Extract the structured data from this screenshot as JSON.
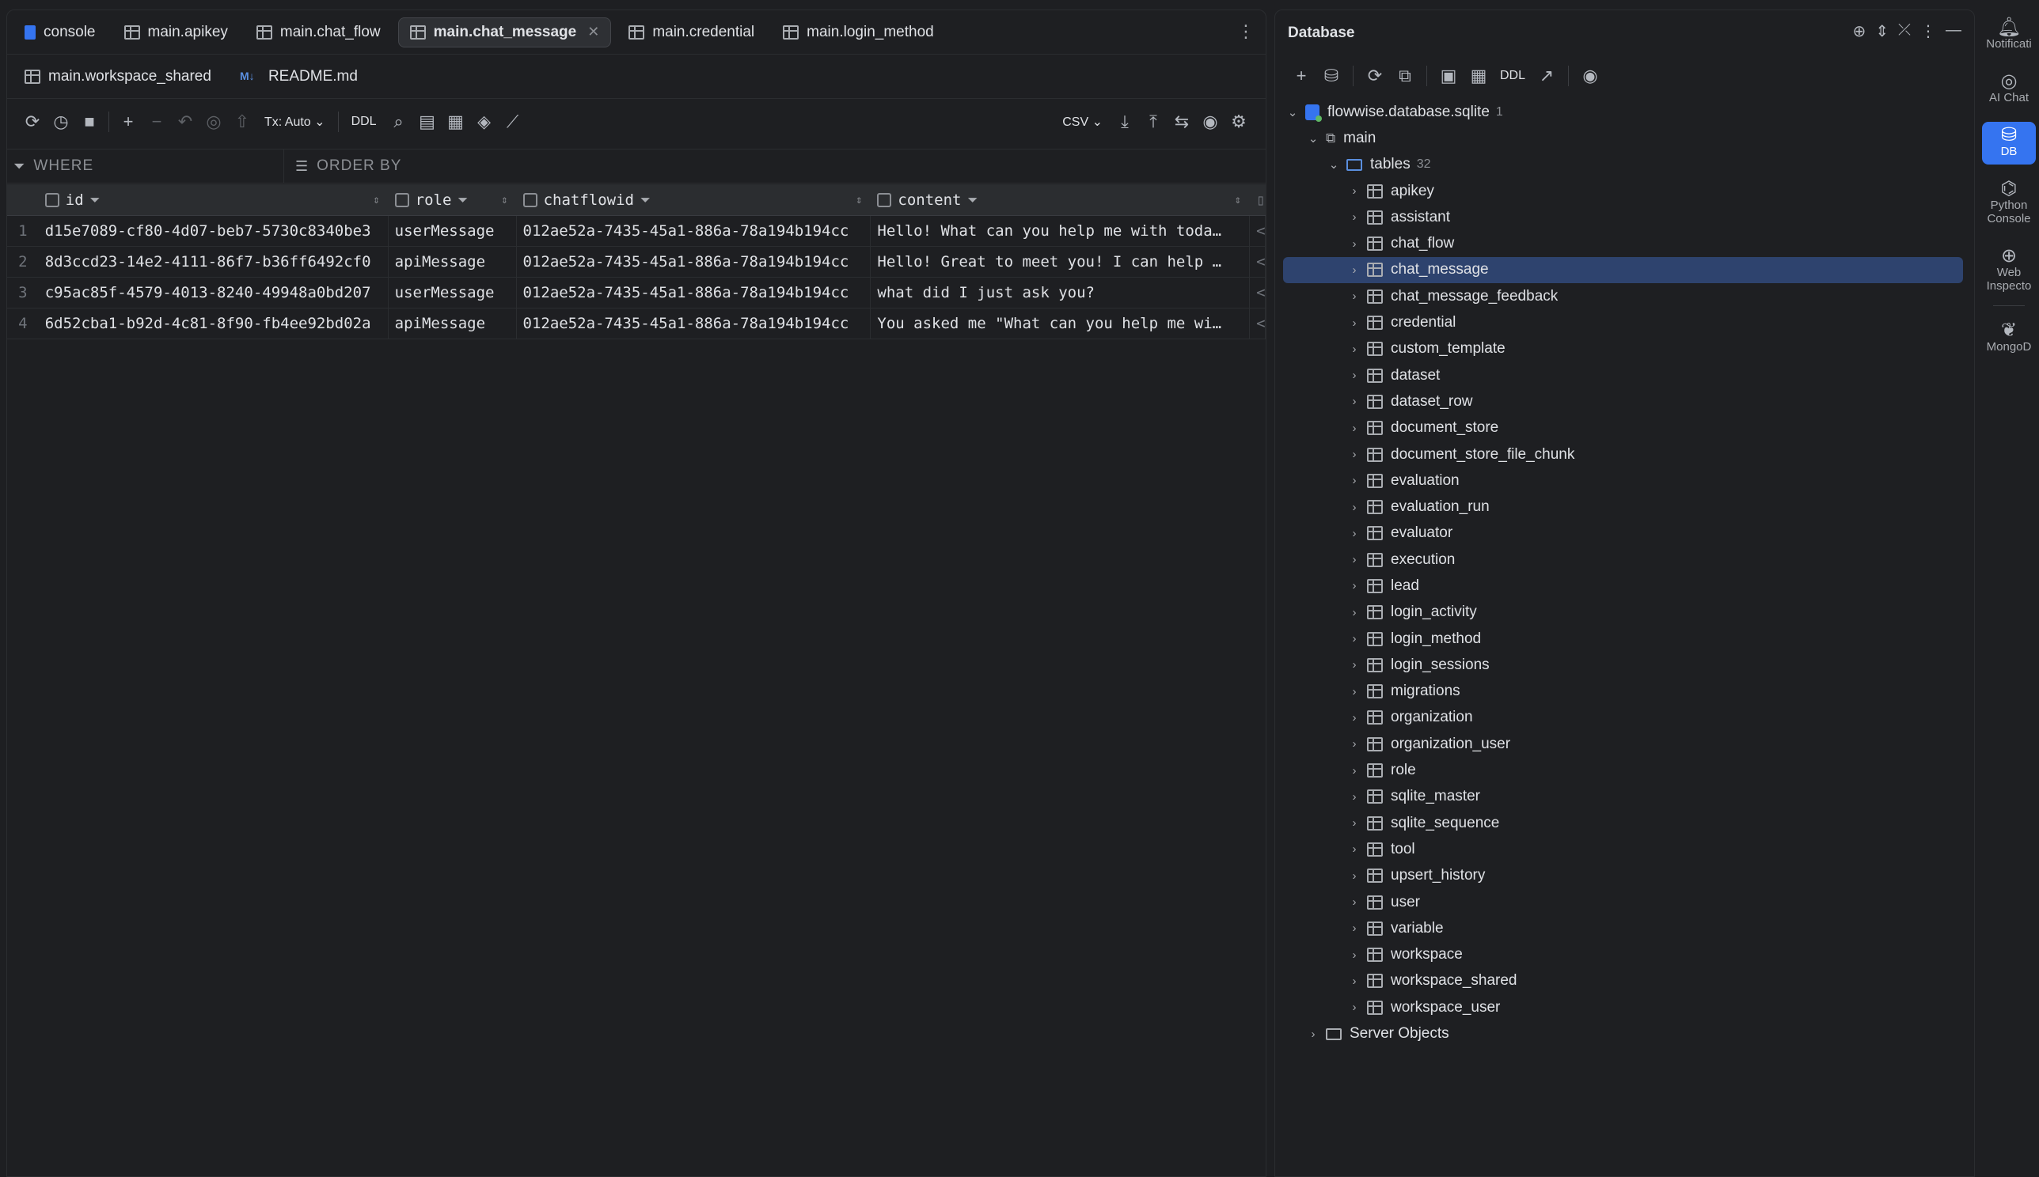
{
  "editor": {
    "tabs_row1": [
      {
        "label": "console",
        "icon": "console-icon",
        "active": false
      },
      {
        "label": "main.apikey",
        "icon": "table-icon",
        "active": false
      },
      {
        "label": "main.chat_flow",
        "icon": "table-icon",
        "active": false
      },
      {
        "label": "main.chat_message",
        "icon": "table-icon",
        "active": true
      },
      {
        "label": "main.credential",
        "icon": "table-icon",
        "active": false
      },
      {
        "label": "main.login_method",
        "icon": "table-icon",
        "active": false
      }
    ],
    "tabs_row2": [
      {
        "label": "main.workspace_shared",
        "icon": "table-icon"
      },
      {
        "label": "README.md",
        "icon": "markdown-icon"
      }
    ],
    "toolbar": {
      "tx_mode": "Tx: Auto",
      "ddl_label": "DDL",
      "export_format": "CSV"
    },
    "filter": {
      "where_label": "WHERE",
      "orderby_label": "ORDER BY"
    },
    "grid": {
      "columns": [
        "id",
        "role",
        "chatflowid",
        "content"
      ],
      "rows": [
        {
          "num": "1",
          "id": "d15e7089-cf80-4d07-beb7-5730c8340be3",
          "role": "userMessage",
          "chatflowid": "012ae52a-7435-45a1-886a-78a194b194cc",
          "content": "Hello! What can you help me with toda…",
          "more": "<"
        },
        {
          "num": "2",
          "id": "8d3ccd23-14e2-4111-86f7-b36ff6492cf0",
          "role": "apiMessage",
          "chatflowid": "012ae52a-7435-45a1-886a-78a194b194cc",
          "content": "Hello! Great to meet you! I can help …",
          "more": "<"
        },
        {
          "num": "3",
          "id": "c95ac85f-4579-4013-8240-49948a0bd207",
          "role": "userMessage",
          "chatflowid": "012ae52a-7435-45a1-886a-78a194b194cc",
          "content": "what did I just ask you?",
          "more": "<"
        },
        {
          "num": "4",
          "id": "6d52cba1-b92d-4c81-8f90-fb4ee92bd02a",
          "role": "apiMessage",
          "chatflowid": "012ae52a-7435-45a1-886a-78a194b194cc",
          "content": "You asked me \"What can you help me wi…",
          "more": "<"
        }
      ]
    }
  },
  "database": {
    "title": "Database",
    "toolbar_ddl": "DDL",
    "datasource": "flowwise.database.sqlite",
    "datasource_count": "1",
    "schema": "main",
    "tables_label": "tables",
    "tables_count": "32",
    "tables": [
      "apikey",
      "assistant",
      "chat_flow",
      "chat_message",
      "chat_message_feedback",
      "credential",
      "custom_template",
      "dataset",
      "dataset_row",
      "document_store",
      "document_store_file_chunk",
      "evaluation",
      "evaluation_run",
      "evaluator",
      "execution",
      "lead",
      "login_activity",
      "login_method",
      "login_sessions",
      "migrations",
      "organization",
      "organization_user",
      "role",
      "sqlite_master",
      "sqlite_sequence",
      "tool",
      "upsert_history",
      "user",
      "variable",
      "workspace",
      "workspace_shared",
      "workspace_user"
    ],
    "selected_table": "chat_message",
    "server_objects": "Server Objects"
  },
  "toolstrip": [
    {
      "label": "Notificati",
      "icon": "bell-icon"
    },
    {
      "label": "AI Chat",
      "icon": "ai-chat-icon"
    },
    {
      "label": "DB",
      "icon": "database-icon",
      "active": true
    },
    {
      "label": "Python Console",
      "icon": "python-icon"
    },
    {
      "label": "Web Inspecto",
      "icon": "globe-icon"
    },
    {
      "label": "MongoD",
      "icon": "mongodb-icon"
    }
  ],
  "colors": {
    "background": "#1e1f22",
    "accent": "#3574f0",
    "selection": "#2e436e"
  }
}
